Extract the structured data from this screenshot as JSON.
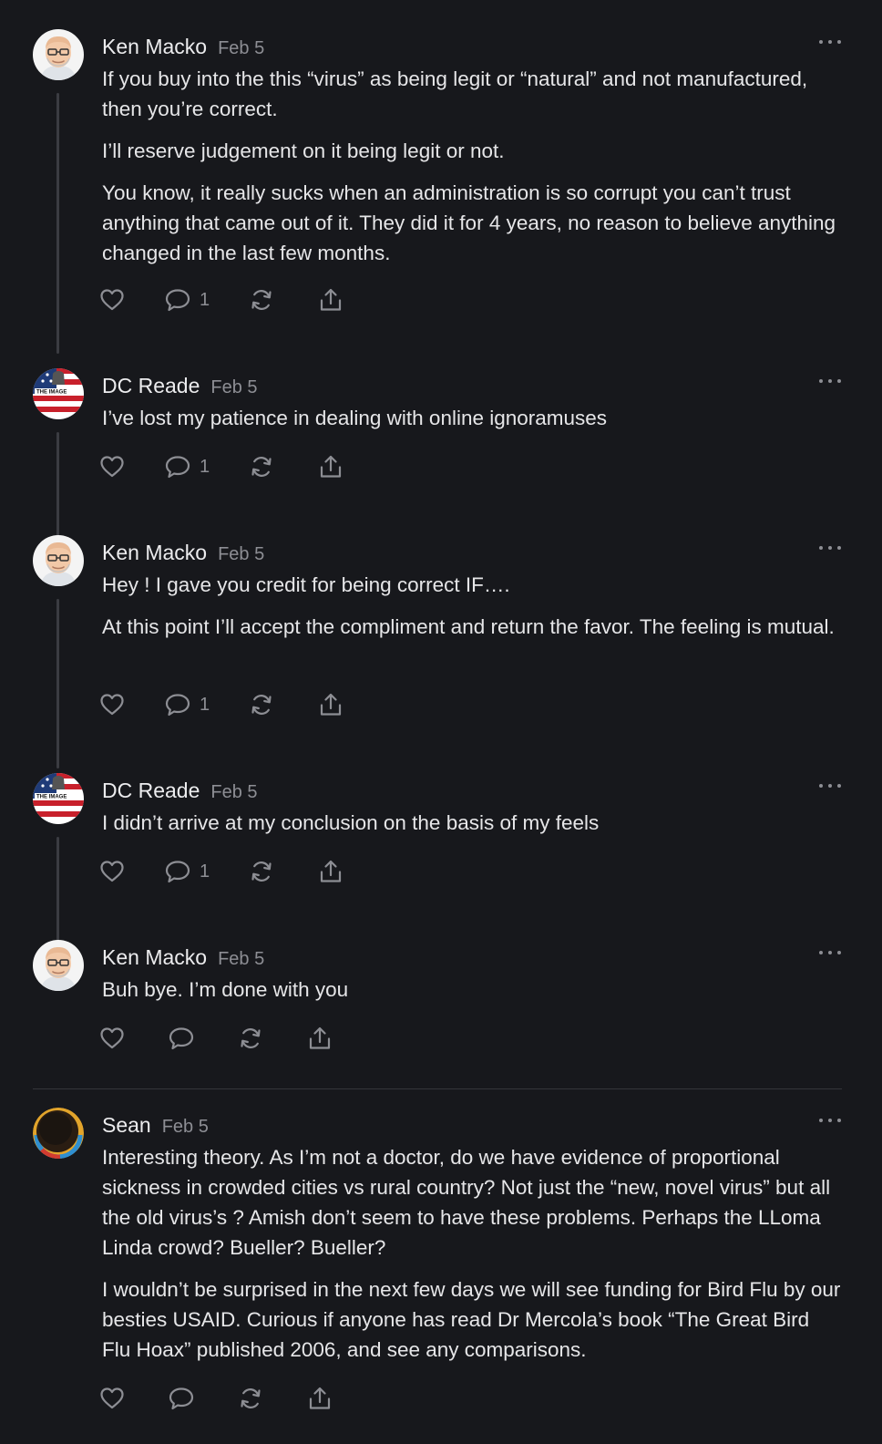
{
  "colors": {
    "background": "#17181c",
    "text": "#e9e9eb",
    "muted": "#8d8e94",
    "thread_line": "#3b3c42"
  },
  "comments": [
    {
      "author": "Ken Macko",
      "date": "Feb 5",
      "avatar_icon": "bald-man-glasses-avatar",
      "paragraphs": [
        "If you buy into the this “virus” as being legit or “natural” and not manufactured, then you’re correct.",
        "I’ll reserve judgement on it being legit or not.",
        "You know, it really sucks when an administration is so corrupt you can’t trust anything that came out of it. They did it for 4 years, no reason to believe anything changed in the last few months."
      ],
      "reply_count": "1"
    },
    {
      "author": "DC Reade",
      "date": "Feb 5",
      "avatar_icon": "the-image-flag-avatar",
      "avatar_text": "THE IMAGE",
      "paragraphs": [
        "I’ve lost my patience in dealing with online ignoramuses"
      ],
      "reply_count": "1"
    },
    {
      "author": "Ken Macko",
      "date": "Feb 5",
      "avatar_icon": "bald-man-glasses-avatar",
      "paragraphs": [
        "Hey ! I gave you credit for being correct IF….",
        "At this point I’ll accept the compliment and return the favor. The feeling is mutual."
      ],
      "reply_count": "1"
    },
    {
      "author": "DC Reade",
      "date": "Feb 5",
      "avatar_icon": "the-image-flag-avatar",
      "avatar_text": "THE IMAGE",
      "paragraphs": [
        "I didn’t arrive at my conclusion on the basis of my feels"
      ],
      "reply_count": "1"
    },
    {
      "author": "Ken Macko",
      "date": "Feb 5",
      "avatar_icon": "bald-man-glasses-avatar",
      "paragraphs": [
        "Buh bye. I’m done with you"
      ],
      "reply_count": ""
    },
    {
      "author": "Sean",
      "date": "Feb 5",
      "avatar_icon": "dark-circle-gradient-avatar",
      "paragraphs": [
        "Interesting theory. As I’m not a doctor, do we have evidence of proportional sickness in crowded cities vs rural country? Not just the “new, novel virus” but all the old virus’s ? Amish don’t seem to have these problems. Perhaps the LLoma Linda crowd? Bueller? Bueller?",
        "I wouldn’t be surprised in the next few days we will see funding for Bird Flu by our besties USAID. Curious if anyone has read Dr Mercola’s book “The Great Bird Flu Hoax” published 2006, and see any comparisons."
      ],
      "reply_count": ""
    }
  ]
}
